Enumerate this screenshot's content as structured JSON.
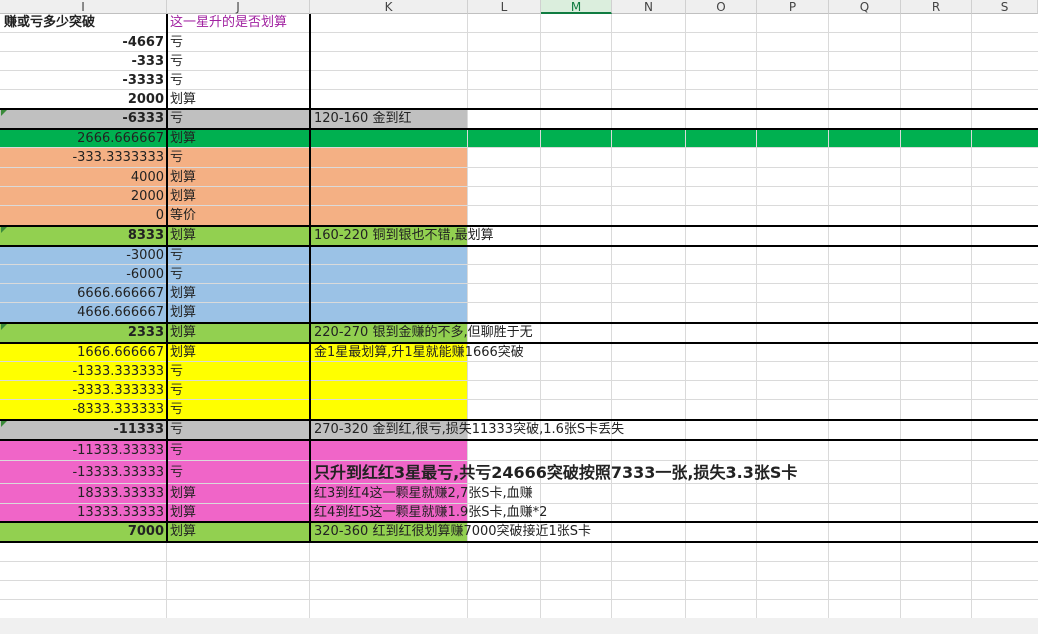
{
  "columns": [
    "I",
    "J",
    "K",
    "L",
    "M",
    "N",
    "O",
    "P",
    "Q",
    "R",
    "S"
  ],
  "selected_column": "M",
  "header_row": {
    "i": "赚或亏多少突破",
    "j": "这一星升的是否划算"
  },
  "rows": [
    {
      "i": "-4667",
      "j": "亏",
      "k": ""
    },
    {
      "i": "-333",
      "j": "亏",
      "k": ""
    },
    {
      "i": "-3333",
      "j": "亏",
      "k": ""
    },
    {
      "i": "2000",
      "j": "划算",
      "k": ""
    },
    {
      "i": "-6333",
      "j": "亏",
      "k": "120-160 金到红"
    },
    {
      "i": "2666.666667",
      "j": "划算",
      "k": ""
    },
    {
      "i": "-333.3333333",
      "j": "亏",
      "k": ""
    },
    {
      "i": "4000",
      "j": "划算",
      "k": ""
    },
    {
      "i": "2000",
      "j": "划算",
      "k": ""
    },
    {
      "i": "0",
      "j": "等价",
      "k": ""
    },
    {
      "i": "8333",
      "j": "划算",
      "k": "160-220 铜到银也不错,最划算"
    },
    {
      "i": "-3000",
      "j": "亏",
      "k": ""
    },
    {
      "i": "-6000",
      "j": "亏",
      "k": ""
    },
    {
      "i": "6666.666667",
      "j": "划算",
      "k": ""
    },
    {
      "i": "4666.666667",
      "j": "划算",
      "k": ""
    },
    {
      "i": "2333",
      "j": "划算",
      "k": "220-270 银到金赚的不多,但聊胜于无"
    },
    {
      "i": "1666.666667",
      "j": "划算",
      "k": "金1星最划算,升1星就能赚1666突破"
    },
    {
      "i": "-1333.333333",
      "j": "亏",
      "k": ""
    },
    {
      "i": "-3333.333333",
      "j": "亏",
      "k": ""
    },
    {
      "i": "-8333.333333",
      "j": "亏",
      "k": ""
    },
    {
      "i": "-11333",
      "j": "亏",
      "k": "270-320 金到红,很亏,损失11333突破,1.6张S卡丢失"
    },
    {
      "i": "-11333.33333",
      "j": "亏",
      "k": ""
    },
    {
      "i": "-13333.33333",
      "j": "亏",
      "k": "只升到红红3星最亏,共亏24666突破按照7333一张,损失3.3张S卡"
    },
    {
      "i": "18333.33333",
      "j": "划算",
      "k": "红3到红4这一颗星就赚2,7张S卡,血赚"
    },
    {
      "i": "13333.33333",
      "j": "划算",
      "k": "红4到红5这一颗星就赚1.9张S卡,血赚*2"
    },
    {
      "i": "7000",
      "j": "划算",
      "k": "320-360 红到红很划算赚7000突破接近1张S卡"
    }
  ],
  "colors": {
    "gray": "#c0c0c0",
    "green_dark": "#00b050",
    "orange": "#f4b084",
    "green_light": "#92d050",
    "blue": "#9bc2e6",
    "yellow": "#ffff00",
    "pink": "#f065c8",
    "purple_text": "#a020a0",
    "selected_header": "#107c41"
  }
}
